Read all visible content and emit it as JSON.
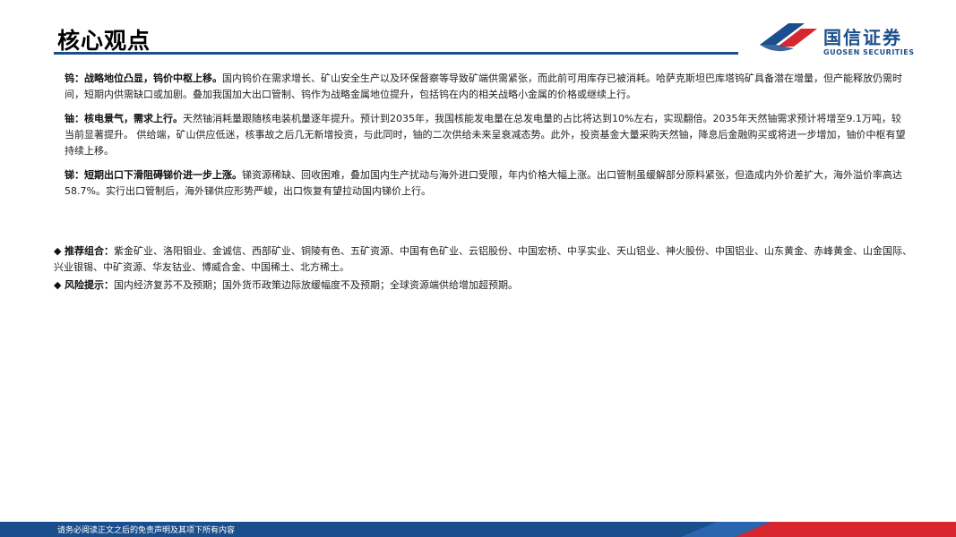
{
  "header": {
    "title": "核心观点"
  },
  "logo": {
    "name_cn": "国信证券",
    "name_en": "GUOSEN SECURITIES",
    "colors": {
      "blue": "#1a4e8c",
      "red": "#d7262e"
    }
  },
  "paragraphs": [
    {
      "head": "钨：战略地位凸显，钨价中枢上移。",
      "body": "国内钨价在需求增长、矿山安全生产以及环保督察等导致矿端供需紧张，而此前可用库存已被消耗。哈萨克斯坦巴库塔钨矿具备潜在增量，但产能释放仍需时间，短期内供需缺口或加剧。叠加我国加大出口管制、钨作为战略金属地位提升，包括钨在内的相关战略小金属的价格或继续上行。"
    },
    {
      "head": "铀：核电景气，需求上行。",
      "body": "天然铀消耗量跟随核电装机量逐年提升。预计到2035年，我国核能发电量在总发电量的占比将达到10%左右，实现翻倍。2035年天然铀需求预计将增至9.1万吨，较当前显著提升。 供给端，矿山供应低迷，核事故之后几无新增投资，与此同时，铀的二次供给未来呈衰减态势。此外，投资基金大量采购天然铀，降息后金融购买或将进一步增加，铀价中枢有望持续上移。"
    },
    {
      "head": "锑：短期出口下滑阻碍锑价进一步上涨。",
      "body": "锑资源稀缺、回收困难，叠加国内生产扰动与海外进口受限，年内价格大幅上涨。出口管制虽缓解部分原料紧张，但造成内外价差扩大，海外溢价率高达58.7%。实行出口管制后，海外锑供应形势严峻，出口恢复有望拉动国内锑价上行。"
    }
  ],
  "bullets": [
    {
      "mark": "◆",
      "label": "推荐组合：",
      "body": "紫金矿业、洛阳钼业、金诚信、西部矿业、铜陵有色、五矿资源、中国有色矿业、云铝股份、中国宏桥、中孚实业、天山铝业、神火股份、中国铝业、山东黄金、赤峰黄金、山金国际、兴业银锡、中矿资源、华友钴业、博威合金、中国稀土、北方稀土。"
    },
    {
      "mark": "◆",
      "label": "风险提示：",
      "body": "国内经济复苏不及预期；国外货币政策边际放缓幅度不及预期；全球资源端供给增加超预期。"
    }
  ],
  "footer": {
    "note": "请务必阅读正文之后的免责声明及其项下所有内容"
  }
}
